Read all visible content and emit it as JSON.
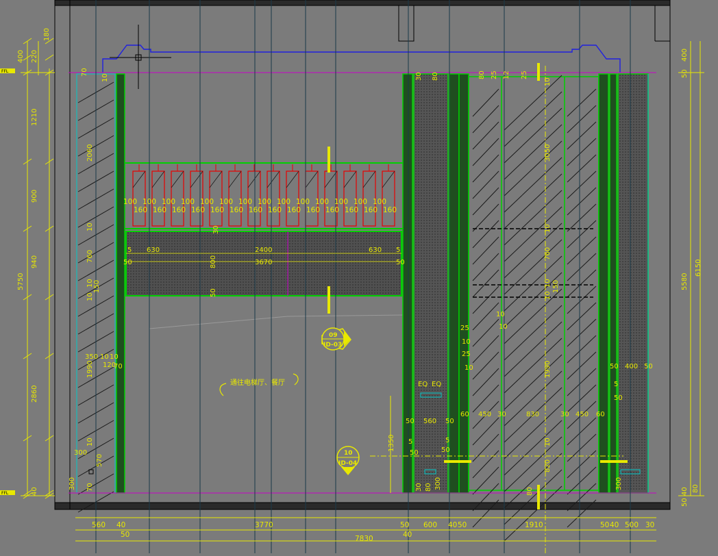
{
  "colors": {
    "background": "#7b7b7b",
    "dimension": "#e8e800",
    "wall": "#00d000",
    "outline": "#000000",
    "hatch": "#1a1a1a",
    "cyan": "#00c8c8",
    "magenta": "#c800c8",
    "red": "#e80000",
    "blue": "#2020e0"
  },
  "left_dimensions": {
    "outer": [
      "400",
      "220",
      "180"
    ],
    "chain": [
      "1210",
      "2060",
      "900",
      "10",
      "940",
      "760",
      "5750",
      "10",
      "10",
      "150",
      "1990",
      "2860",
      "10",
      "570",
      "300",
      "40",
      "70"
    ],
    "level_marks": [
      "FFL",
      "FFL"
    ]
  },
  "right_dimensions": {
    "chain": [
      "400",
      "50",
      "5580",
      "6150",
      "40",
      "80",
      "50"
    ]
  },
  "bottom_dimensions": {
    "row1": [
      "560",
      "40",
      "3770",
      "50",
      "600",
      "40",
      "50",
      "1910",
      "50",
      "40",
      "500",
      "30"
    ],
    "row2": [
      "50",
      "40",
      "7830"
    ]
  },
  "cabinet_labels": {
    "repeat_100": "100",
    "repeat_160": "160",
    "count": 14
  },
  "panel_dims": {
    "d1": "630",
    "d2": "2400",
    "d3": "630",
    "d4": "3670",
    "d5": "800",
    "d6": "50",
    "d7": "5",
    "d8": "50",
    "d9": "5",
    "d10": "50",
    "d11": "70",
    "d12": "10",
    "d13": "30"
  },
  "left_inner_dims": [
    "350",
    "10",
    "10",
    "120",
    "70",
    "300"
  ],
  "door_dims": {
    "top": [
      "80",
      "25",
      "12",
      "25",
      "10",
      "3050",
      "10",
      "760",
      "10",
      "10",
      "150",
      "1990",
      "10",
      "820",
      "80"
    ],
    "row": [
      "60",
      "450",
      "30",
      "830",
      "30",
      "450",
      "60"
    ],
    "right_col": [
      "50",
      "400",
      "50",
      "5",
      "50"
    ],
    "misc": [
      "25",
      "10",
      "25",
      "10",
      "10",
      "10"
    ]
  },
  "column_dims": {
    "top": [
      "30",
      "80"
    ],
    "eq": [
      "EQ",
      "EQ"
    ],
    "row": [
      "50",
      "560",
      "50"
    ],
    "misc": [
      "5",
      "50",
      "5",
      "50"
    ],
    "bottom": [
      "30",
      "80",
      "300",
      "1350"
    ]
  },
  "section_marks": [
    {
      "num": "09",
      "ref": "ID-03"
    },
    {
      "num": "10",
      "ref": "ID-04"
    }
  ],
  "annotation": "通往电梯厅、餐厅"
}
